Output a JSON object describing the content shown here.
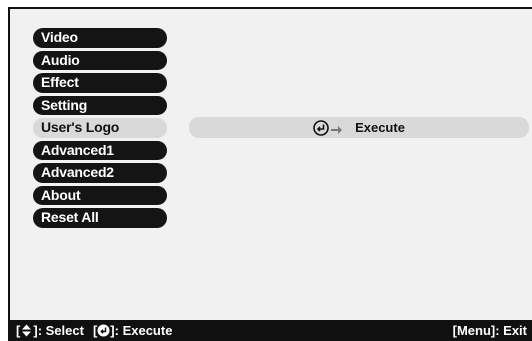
{
  "menu": {
    "items": [
      {
        "label": "Video"
      },
      {
        "label": "Audio"
      },
      {
        "label": "Effect"
      },
      {
        "label": "Setting"
      },
      {
        "label": "User's Logo"
      },
      {
        "label": "Advanced1"
      },
      {
        "label": "Advanced2"
      },
      {
        "label": "About"
      },
      {
        "label": "Reset All"
      }
    ],
    "selected_index": 4
  },
  "content": {
    "execute_label": "Execute",
    "icons": [
      "enter-icon",
      "arrow-right-icon"
    ]
  },
  "status_bar": {
    "select_hint": ": Select",
    "execute_hint": ": Execute",
    "menu_exit_hint": "[Menu]: Exit",
    "icons": [
      "up-down-icon",
      "enter-icon"
    ]
  },
  "colors": {
    "menu_item_bg": "#141414",
    "menu_item_selected_bg": "#d9d9d9",
    "panel_bg": "#f1f1f1",
    "status_bar_bg": "#101010"
  }
}
